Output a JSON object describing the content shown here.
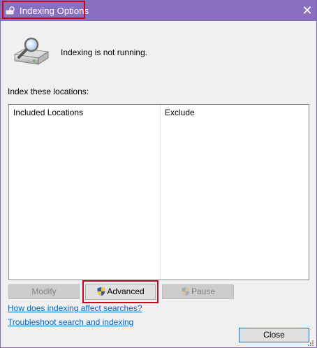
{
  "window": {
    "title": "Indexing Options",
    "close_symbol": "✕"
  },
  "status": {
    "text": "Indexing is not running."
  },
  "locations": {
    "label": "Index these locations:",
    "columns": [
      "Included Locations",
      "Exclude"
    ],
    "rows": []
  },
  "buttons": {
    "modify": "Modify",
    "advanced": "Advanced",
    "pause": "Pause",
    "close": "Close"
  },
  "links": {
    "how": "How does indexing affect searches?",
    "troubleshoot": "Troubleshoot search and indexing"
  },
  "icons": {
    "app": "indexing-options-icon",
    "drive": "drive-magnifier-icon",
    "shield": "uac-shield-icon",
    "close": "close-icon",
    "grip": "resize-grip-icon"
  },
  "colors": {
    "titlebar": "#8a6fc1",
    "highlight": "#d0021b",
    "link": "#0066cc"
  }
}
